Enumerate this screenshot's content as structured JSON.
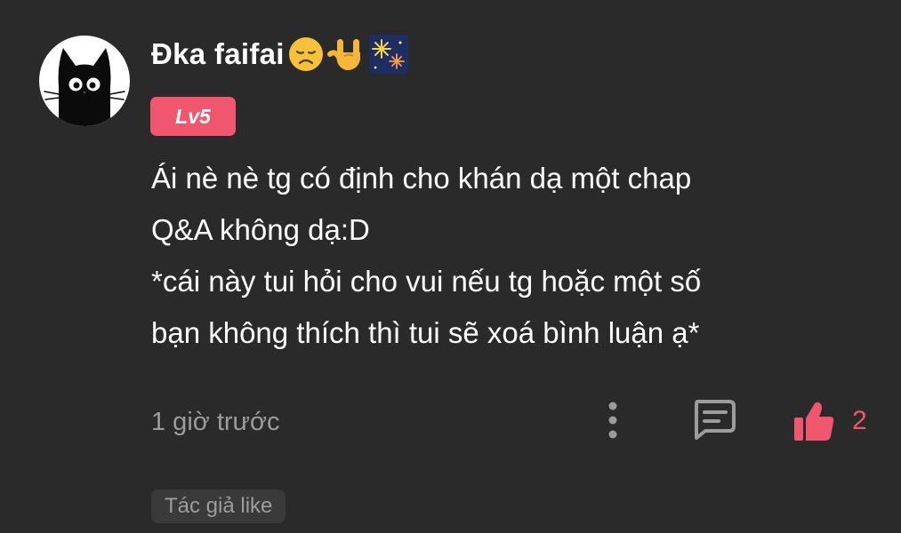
{
  "comment": {
    "username": "Đka faifai",
    "username_emojis": [
      "disappointed-face",
      "sign-of-the-horns",
      "fireworks"
    ],
    "level": "Lv5",
    "body_lines": [
      "Ái nè nè tg có định cho khán dạ một chap",
      "Q&A không dạ:D",
      "*cái này tui hỏi cho vui nếu tg hoặc một số",
      "bạn không thích thì tui sẽ xoá bình luận ạ*"
    ],
    "timestamp": "1 giờ trước",
    "like_count": "2",
    "author_like_label": "Tác giả like"
  },
  "colors": {
    "background": "#2a2a2b",
    "accent": "#f0566d",
    "muted_text": "#9c9c9c",
    "primary_text": "#ffffff"
  },
  "icons": {
    "avatar": "black-cat-avatar",
    "more": "more-vertical-icon",
    "reply": "comment-icon",
    "like": "thumbs-up-icon"
  }
}
